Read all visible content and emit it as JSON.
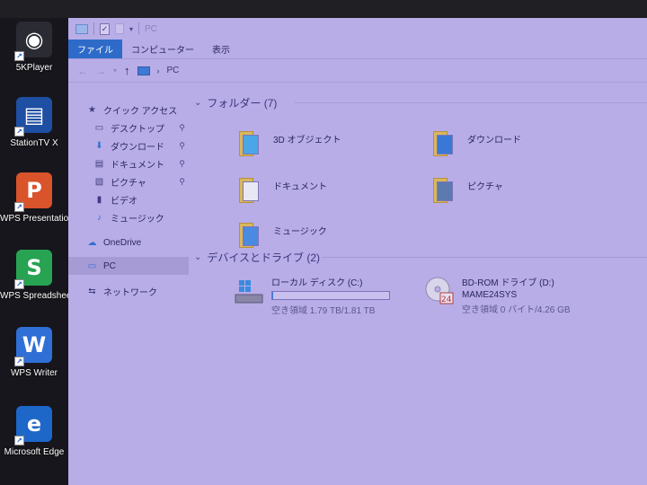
{
  "desktop_icons": [
    {
      "label": "5KPlayer",
      "icon": "5kplayer-icon",
      "color": "#2b2b33",
      "glyph": "◉"
    },
    {
      "label": "StationTV X",
      "icon": "stationtv-icon",
      "color": "#1e4fa3",
      "glyph": "▤"
    },
    {
      "label": "WPS Presentation",
      "icon": "wps-presentation-icon",
      "color": "#d9532b",
      "glyph": "P"
    },
    {
      "label": "WPS Spreadsheets",
      "icon": "wps-spreadsheets-icon",
      "color": "#27a352",
      "glyph": "S"
    },
    {
      "label": "WPS Writer",
      "icon": "wps-writer-icon",
      "color": "#2f6fd6",
      "glyph": "W"
    },
    {
      "label": "Microsoft Edge",
      "icon": "edge-icon",
      "color": "#1d67c9",
      "glyph": "e"
    }
  ],
  "window": {
    "title": "PC",
    "ribbon_tabs": [
      "ファイル",
      "コンピューター",
      "表示"
    ],
    "address": "PC"
  },
  "sidebar": {
    "items": [
      {
        "label": "クイック アクセス",
        "icon": "star-icon",
        "pinned": false,
        "selected": false,
        "indent": 0
      },
      {
        "label": "デスクトップ",
        "icon": "desktop-icon",
        "pinned": true,
        "selected": false,
        "indent": 1
      },
      {
        "label": "ダウンロード",
        "icon": "download-icon",
        "pinned": true,
        "selected": false,
        "indent": 1
      },
      {
        "label": "ドキュメント",
        "icon": "document-icon",
        "pinned": true,
        "selected": false,
        "indent": 1
      },
      {
        "label": "ピクチャ",
        "icon": "picture-icon",
        "pinned": true,
        "selected": false,
        "indent": 1
      },
      {
        "label": "ビデオ",
        "icon": "video-icon",
        "pinned": false,
        "selected": false,
        "indent": 1
      },
      {
        "label": "ミュージック",
        "icon": "music-icon",
        "pinned": false,
        "selected": false,
        "indent": 1
      },
      {
        "label": "OneDrive",
        "icon": "cloud-icon",
        "pinned": false,
        "selected": false,
        "indent": 0
      },
      {
        "label": "PC",
        "icon": "pc-icon",
        "pinned": false,
        "selected": true,
        "indent": 0
      },
      {
        "label": "ネットワーク",
        "icon": "network-icon",
        "pinned": false,
        "selected": false,
        "indent": 0
      }
    ]
  },
  "folders_group": {
    "header": "フォルダー (7)",
    "items": [
      {
        "label": "3D オブジェクト",
        "icon": "3d-objects-icon"
      },
      {
        "label": "ダウンロード",
        "icon": "downloads-folder-icon"
      },
      {
        "label": "ドキュメント",
        "icon": "documents-folder-icon"
      },
      {
        "label": "ピクチャ",
        "icon": "pictures-folder-icon"
      },
      {
        "label": "ミュージック",
        "icon": "music-folder-icon"
      }
    ]
  },
  "devices_group": {
    "header": "デバイスとドライブ (2)",
    "drives": [
      {
        "name": "ローカル ディスク (C:)",
        "volume": "",
        "space": "空き領域 1.79 TB/1.81 TB",
        "used_fraction": 0.01,
        "icon": "hard-drive-icon"
      },
      {
        "name": "BD-ROM ドライブ (D:)",
        "volume": "MAME24SYS",
        "space": "空き領域 0 バイト/4.26 GB",
        "icon": "bd-rom-icon"
      }
    ]
  }
}
